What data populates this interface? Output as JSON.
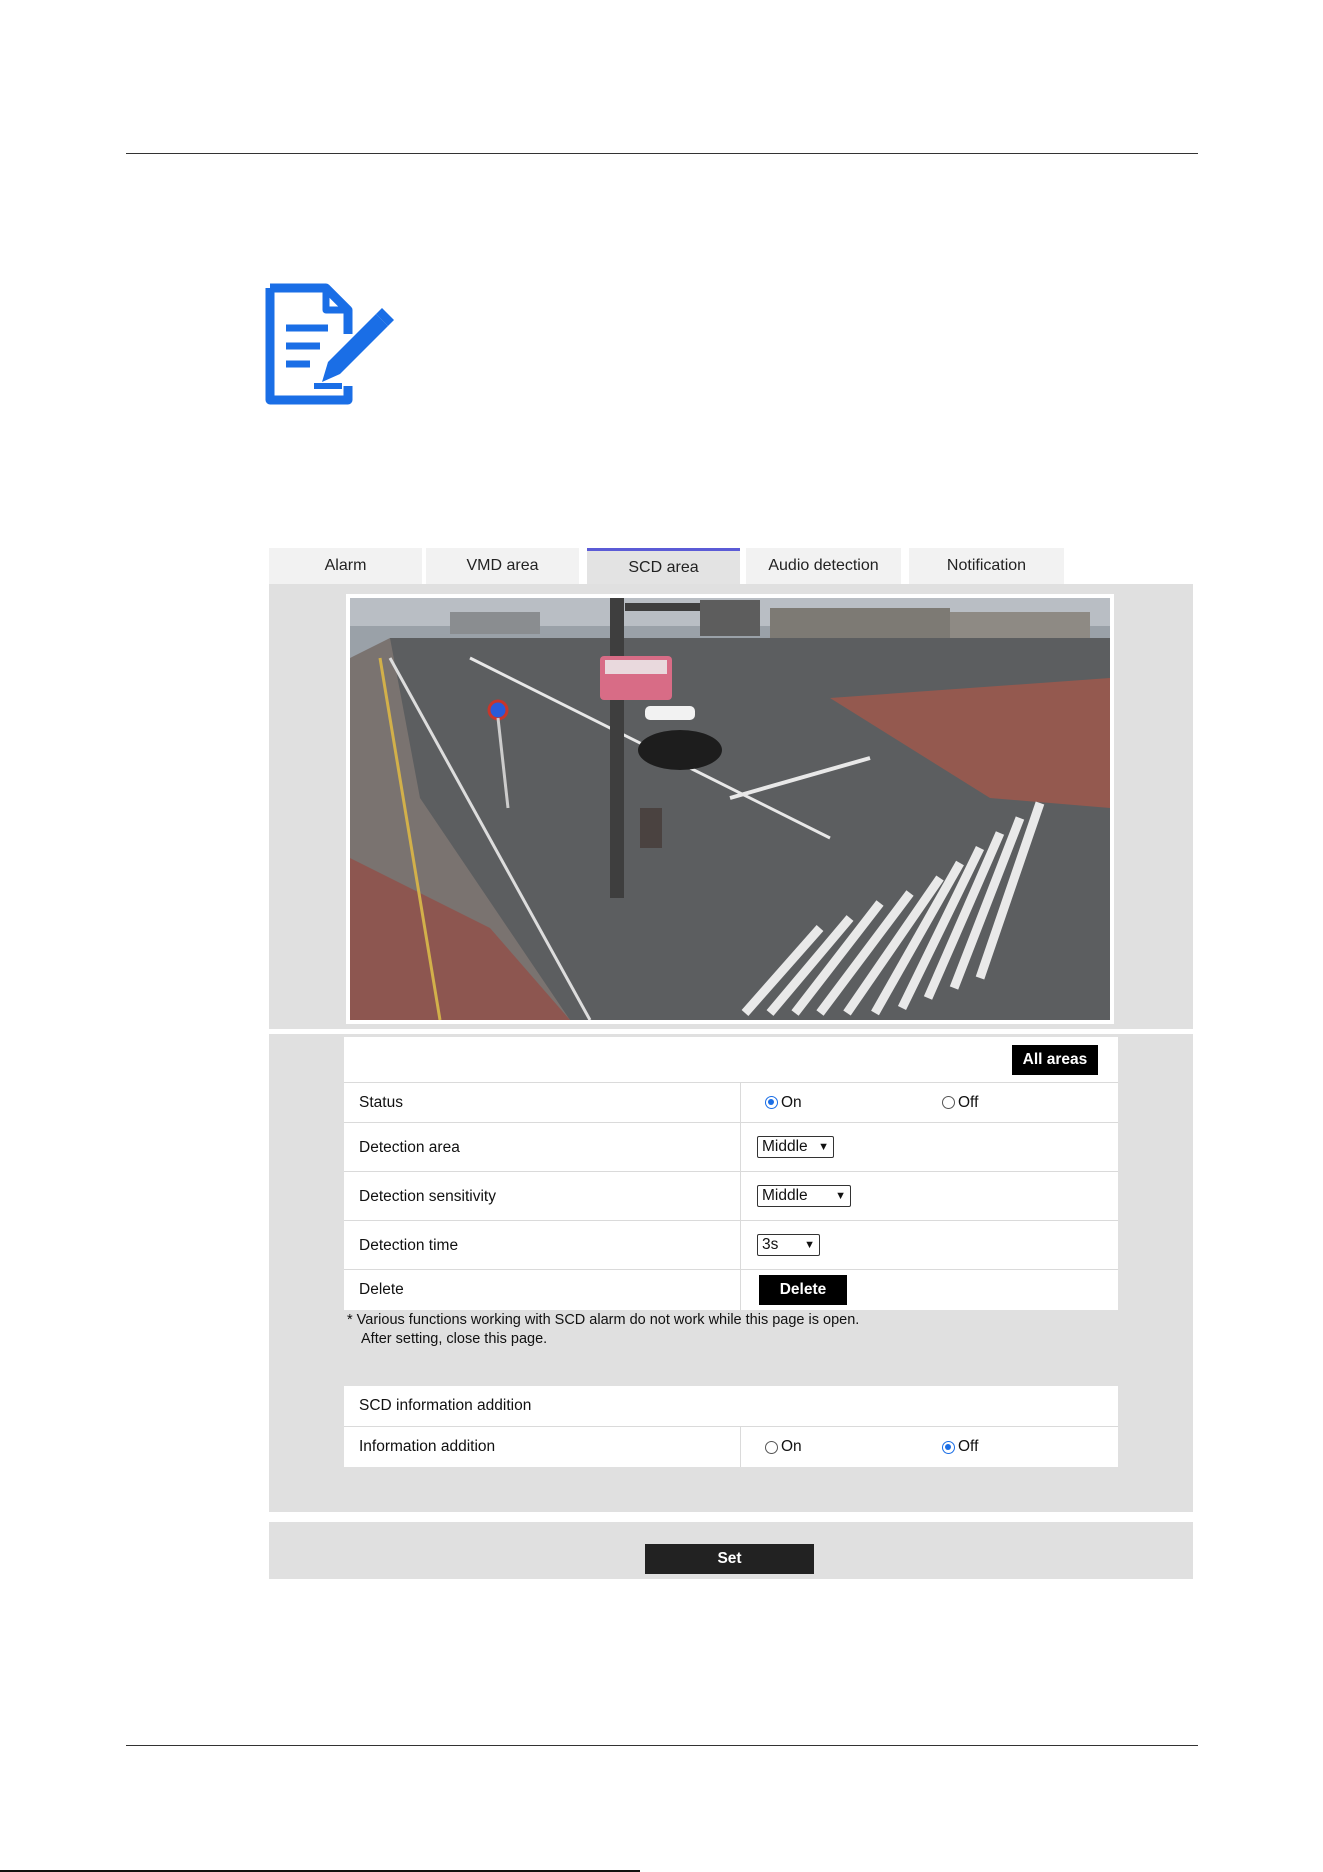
{
  "tabs": [
    {
      "label": "Alarm",
      "active": false
    },
    {
      "label": "VMD area",
      "active": false
    },
    {
      "label": "SCD area",
      "active": true
    },
    {
      "label": "Audio detection",
      "active": false
    },
    {
      "label": "Notification",
      "active": false
    }
  ],
  "scd": {
    "all_areas_label": "All areas",
    "status": {
      "label": "Status",
      "options": [
        "On",
        "Off"
      ],
      "selected": "On"
    },
    "detection_area": {
      "label": "Detection area",
      "value": "Middle"
    },
    "detection_sensitivity": {
      "label": "Detection sensitivity",
      "value": "Middle"
    },
    "detection_time": {
      "label": "Detection time",
      "value": "3s"
    },
    "delete": {
      "label": "Delete",
      "button": "Delete"
    },
    "note_line1": "* Various functions working with SCD alarm do not work while this page is open.",
    "note_line2": "After setting, close this page."
  },
  "info": {
    "section_title": "SCD information addition",
    "information_addition": {
      "label": "Information addition",
      "options": [
        "On",
        "Off"
      ],
      "selected": "Off"
    }
  },
  "set_label": "Set",
  "colors": {
    "accent": "#1a6ee6",
    "tab_active_border": "#5b5bd6",
    "icon": "#1a6ee6"
  }
}
